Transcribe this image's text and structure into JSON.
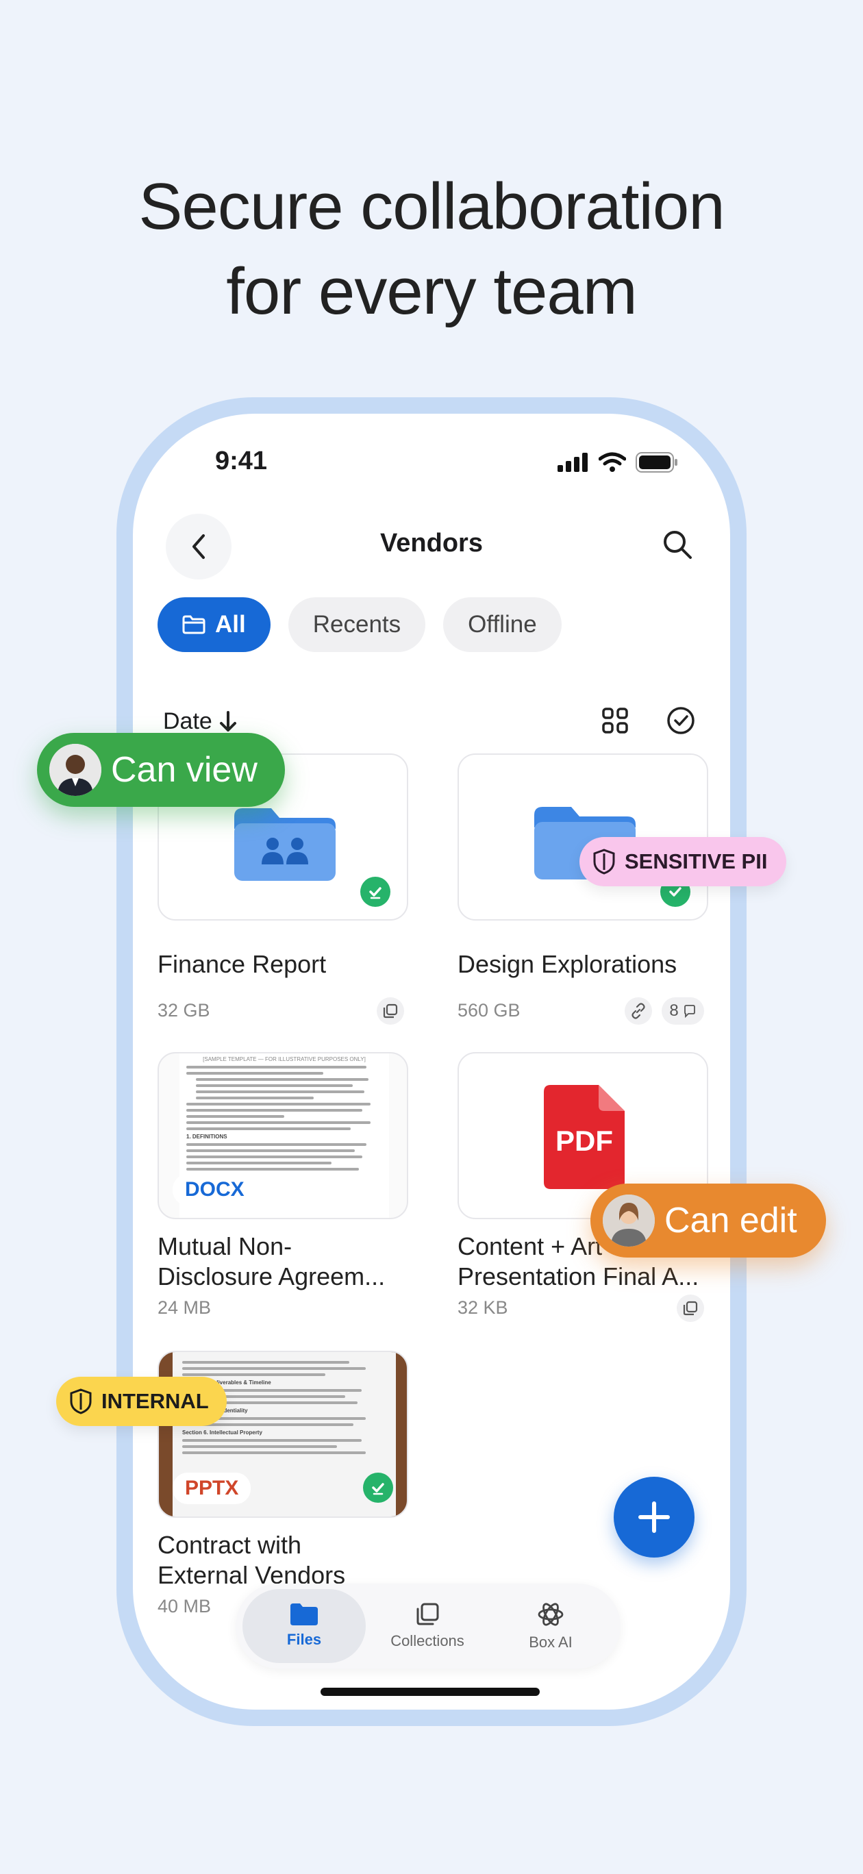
{
  "headline": {
    "line1": "Secure collaboration",
    "line2": "for every team"
  },
  "status_bar": {
    "time": "9:41"
  },
  "nav": {
    "title": "Vendors"
  },
  "filters": [
    {
      "label": "All",
      "active": true
    },
    {
      "label": "Recents",
      "active": false
    },
    {
      "label": "Offline",
      "active": false
    }
  ],
  "sort": {
    "label": "Date"
  },
  "items": [
    {
      "name": "Finance Report",
      "size": "32 GB",
      "kind": "shared-folder"
    },
    {
      "name": "Design Explorations",
      "size": "560 GB",
      "kind": "folder",
      "comments": "8"
    },
    {
      "name_line1": "Mutual Non-",
      "name_line2": "Disclosure Agreem...",
      "size": "24 MB",
      "kind": "document",
      "tag": "DOCX"
    },
    {
      "name_line1": "Content + Art",
      "name_line2": "Presentation Final A...",
      "size": "32 KB",
      "kind": "pdf",
      "tag": "PDF"
    },
    {
      "name_line1": "Contract with",
      "name_line2": "External Vendors",
      "size": "40 MB",
      "kind": "presentation",
      "tag": "PPTX"
    }
  ],
  "doc_preview": {
    "header": "[SAMPLE TEMPLATE — FOR ILLUSTRATIVE PURPOSES ONLY]",
    "heading": "1. DEFINITIONS"
  },
  "pptx_preview": {
    "section1": "Section 4. Deliverables & Timeline",
    "section2": "Section 5. Confidentiality",
    "section3": "Section 6. Intellectual Property"
  },
  "tabs": [
    {
      "label": "Files",
      "active": true
    },
    {
      "label": "Collections",
      "active": false
    },
    {
      "label": "Box AI",
      "active": false
    }
  ],
  "overlays": {
    "can_view": "Can view",
    "can_edit": "Can edit",
    "sensitive": "SENSITIVE PII",
    "internal": "INTERNAL"
  },
  "colors": {
    "accent": "#1769d6",
    "can_view": "#3aa84a",
    "can_edit": "#e8892f",
    "sensitive_bg": "#f9c6ec",
    "internal_bg": "#fbd54e",
    "pdf_red": "#e3262e"
  }
}
